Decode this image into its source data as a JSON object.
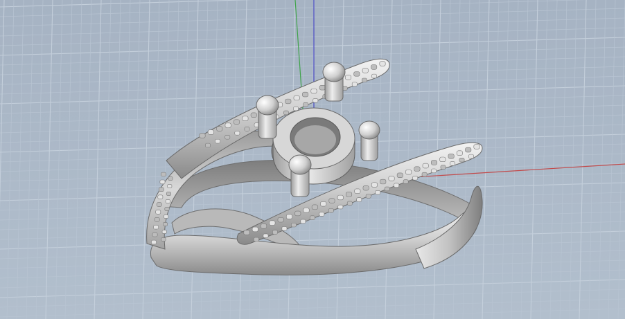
{
  "viewport": {
    "view_mode": "perspective",
    "display_mode": "shaded",
    "grid_visible": true,
    "background_color": "#a9b6c6",
    "grid_minor_color": "#b8c4d2",
    "grid_major_color": "#c4cfdb",
    "axes": {
      "x_color": "#c24a4a",
      "y_color": "#3fa34a",
      "z_color": "#4a4ac4"
    },
    "model": {
      "object": "ring-with-four-prong-setting",
      "material_color": "#c9c9c9"
    }
  }
}
